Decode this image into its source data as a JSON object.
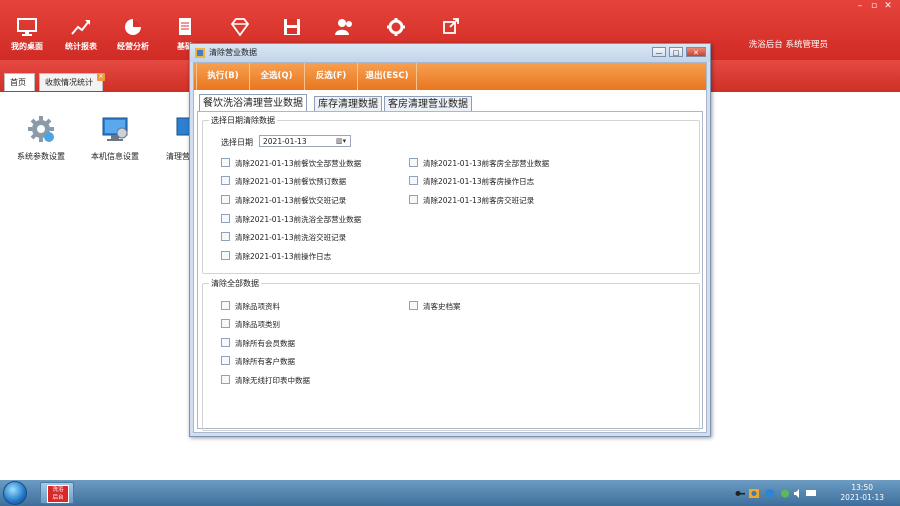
{
  "toolbar": {
    "items": [
      {
        "label": "我的桌面",
        "icon": "monitor-icon"
      },
      {
        "label": "统计报表",
        "icon": "chart-icon"
      },
      {
        "label": "经营分析",
        "icon": "pie-chart-icon"
      },
      {
        "label": "基础",
        "icon": "document-icon"
      },
      {
        "label": "",
        "icon": "diamond-icon"
      },
      {
        "label": "",
        "icon": "save-icon"
      },
      {
        "label": "",
        "icon": "user-icon"
      },
      {
        "label": "",
        "icon": "gear-icon"
      },
      {
        "label": "",
        "icon": "external-link-icon"
      }
    ],
    "user_label": "洗浴后台 系统管理员"
  },
  "page_tabs": [
    {
      "label": "首页"
    },
    {
      "label": "收款情况统计"
    }
  ],
  "desktop_items": [
    {
      "label": "系统参数设置",
      "icon": "settings-gear-icon"
    },
    {
      "label": "本机信息设置",
      "icon": "computer-settings-icon"
    },
    {
      "label": "清理营",
      "icon": "cleanup-icon"
    }
  ],
  "dialog": {
    "title": "清除营业数据",
    "controls": {
      "minimize": "—",
      "maximize": "□",
      "close": "✕"
    },
    "actions": [
      "执行(B)",
      "全选(Q)",
      "反选(F)",
      "退出(ESC)"
    ],
    "tabs": [
      "餐饮洗浴清理营业数据",
      "库存清理数据",
      "客房清理营业数据"
    ],
    "date_group": {
      "title": "选择日期清除数据",
      "date_label": "选择日期",
      "date_value": "2021-01-13",
      "left_options": [
        "清除2021-01-13前餐饮全部营业数据",
        "清除2021-01-13前餐饮预订数据",
        "清除2021-01-13前餐饮交班记录",
        "清除2021-01-13前洗浴全部营业数据",
        "清除2021-01-13前洗浴交班记录",
        "清除2021-01-13前操作日志"
      ],
      "right_options": [
        "清除2021-01-13前客房全部营业数据",
        "清除2021-01-13前客房操作日志",
        "清除2021-01-13前客房交班记录"
      ]
    },
    "all_group": {
      "title": "清除全部数据",
      "left_options": [
        "清除品项资料",
        "清除品项类别",
        "清除所有会员数据",
        "清除所有客户数据",
        "清除无线打印表中数据"
      ],
      "right_options": [
        "清客史档案"
      ]
    }
  },
  "taskbar": {
    "app_icon_text": "洗浴\n后台",
    "time": "13:50",
    "date": "2021-01-13"
  },
  "colors": {
    "toolbar_red": "#d8342c",
    "dialog_orange": "#ee8129",
    "taskbar_blue": "#4f80ab"
  }
}
